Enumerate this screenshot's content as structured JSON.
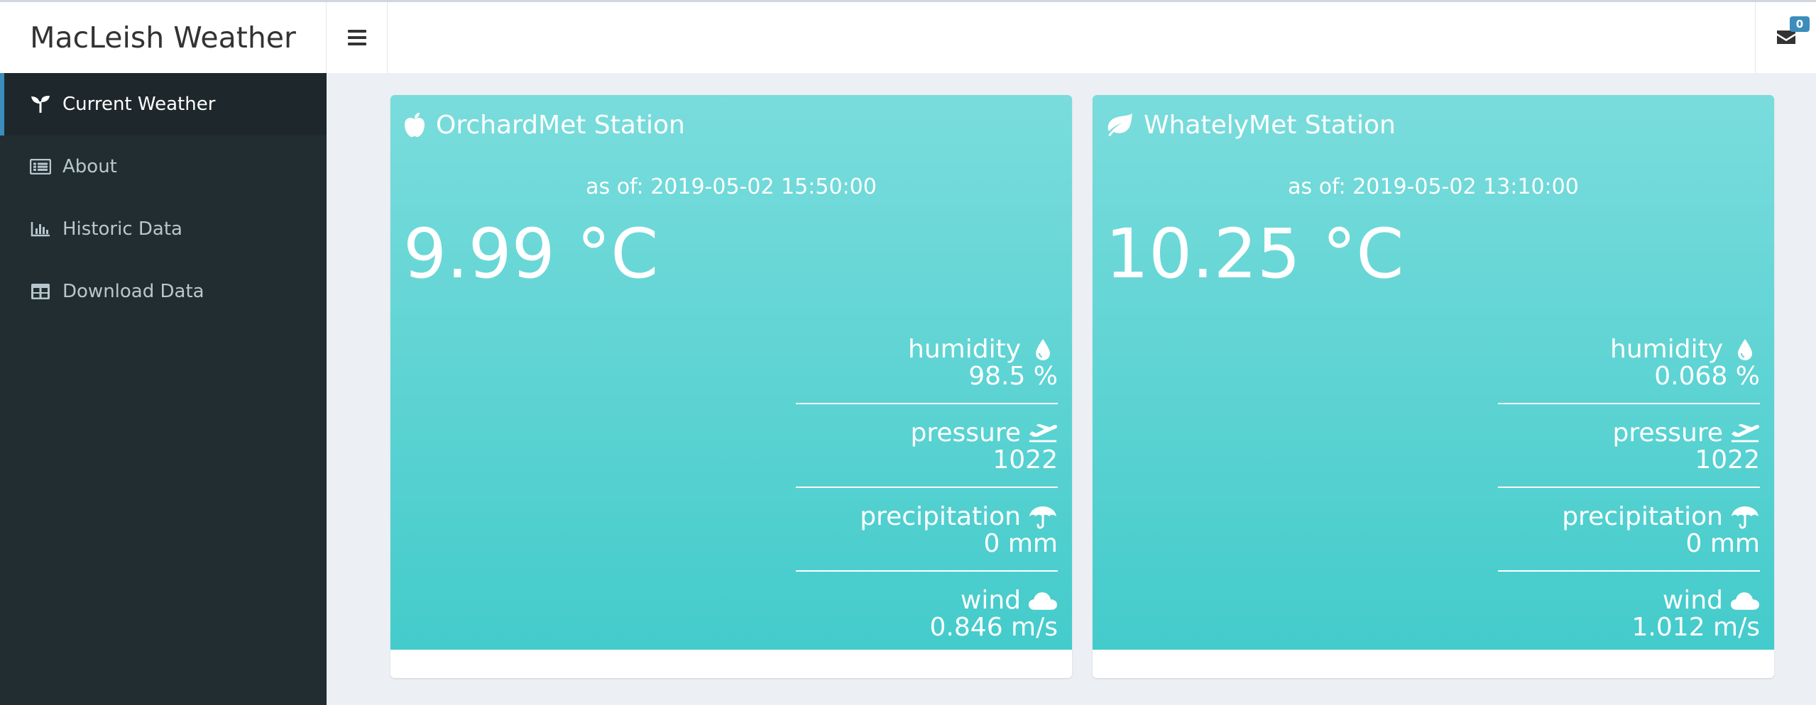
{
  "header": {
    "brand": "MacLeish Weather",
    "messages_count": "0"
  },
  "sidebar": {
    "items": [
      {
        "label": "Current Weather",
        "icon": "seedling-icon",
        "active": true
      },
      {
        "label": "About",
        "icon": "list-icon"
      },
      {
        "label": "Historic Data",
        "icon": "bar-chart-icon"
      },
      {
        "label": "Download Data",
        "icon": "table-icon"
      }
    ]
  },
  "stations": [
    {
      "name": "OrchardMet Station",
      "icon": "apple-icon",
      "as_of": "as of: 2019-05-02 15:50:00",
      "temperature": "9.99 °C",
      "metrics": [
        {
          "label": "humidity",
          "value": "98.5 %",
          "icon": "tint-icon"
        },
        {
          "label": "pressure",
          "value": "1022",
          "icon": "plane-icon"
        },
        {
          "label": "precipitation",
          "value": "0 mm",
          "icon": "umbrella-icon"
        },
        {
          "label": "wind",
          "value": "0.846 m/s",
          "icon": "cloud-icon"
        }
      ]
    },
    {
      "name": "WhatelyMet Station",
      "icon": "leaf-icon",
      "as_of": "as of: 2019-05-02 13:10:00",
      "temperature": "10.25 °C",
      "metrics": [
        {
          "label": "humidity",
          "value": "0.068 %",
          "icon": "tint-icon"
        },
        {
          "label": "pressure",
          "value": "1022",
          "icon": "plane-icon"
        },
        {
          "label": "precipitation",
          "value": "0 mm",
          "icon": "umbrella-icon"
        },
        {
          "label": "wind",
          "value": "1.012 m/s",
          "icon": "cloud-icon"
        }
      ]
    }
  ],
  "colors": {
    "sidebar_bg": "#222d32",
    "sidebar_active_bg": "#1e282c",
    "accent": "#3c8dbc",
    "card_gradient_top": "#7adcdc",
    "card_gradient_bottom": "#44cbcb",
    "page_bg": "#ecf0f5"
  }
}
